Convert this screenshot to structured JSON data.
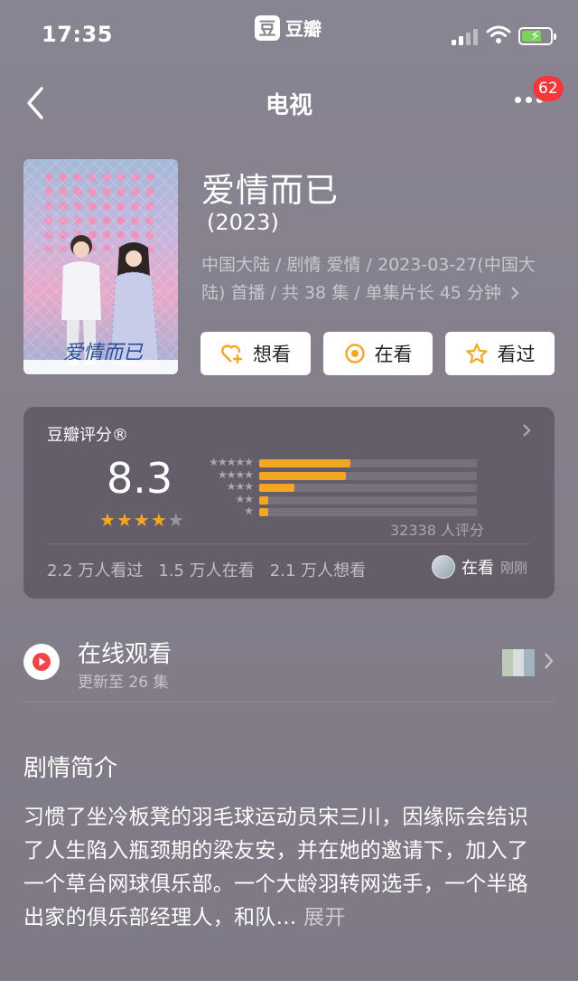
{
  "status_bar": {
    "time": "17:35",
    "app_logo": "豆",
    "app_name": "豆瓣",
    "icons": [
      "signal-icon",
      "wifi-icon",
      "battery-charging-icon"
    ],
    "battery_color": "#7bd35a"
  },
  "nav": {
    "title": "电视",
    "badge_count": "62",
    "badge_color": "#f5373c"
  },
  "poster": {
    "title_art": "爱情而已"
  },
  "show": {
    "title": "爱情而已",
    "year": "(2023)",
    "meta": "中国大陆 / 剧情 爱情 / 2023-03-27(中国大陆) 首播 / 共 38 集 / 单集片长 45 分钟"
  },
  "actions": {
    "want": "想看",
    "watching": "在看",
    "watched": "看过",
    "icon_color": "#f5a623"
  },
  "rating": {
    "label": "豆瓣评分®",
    "score": "8.3",
    "stars_filled": 4,
    "stars_total": 5,
    "distribution": [
      {
        "stars": "★★★★★",
        "fraction": 0.42
      },
      {
        "stars": "★★★★",
        "fraction": 0.4
      },
      {
        "stars": "★★★",
        "fraction": 0.16
      },
      {
        "stars": "★★",
        "fraction": 0.04
      },
      {
        "stars": "★",
        "fraction": 0.04
      }
    ],
    "count": "32338 人评分",
    "stats": [
      "2.2 万人看过",
      "1.5 万人在看",
      "2.1 万人想看"
    ],
    "my_status": "在看",
    "my_status_time": "刚刚",
    "accent_color": "#f5a623"
  },
  "online": {
    "title": "在线观看",
    "subtitle": "更新至 26 集",
    "play_color": "#f2444a"
  },
  "synopsis": {
    "heading": "剧情简介",
    "text": "习惯了坐冷板凳的羽毛球运动员宋三川，因缘际会结识了人生陷入瓶颈期的梁友安，并在她的邀请下，加入了一个草台网球俱乐部。一个大龄羽转网选手，一个半路出家的俱乐部经理人，和队...",
    "expand_label": "展开"
  }
}
